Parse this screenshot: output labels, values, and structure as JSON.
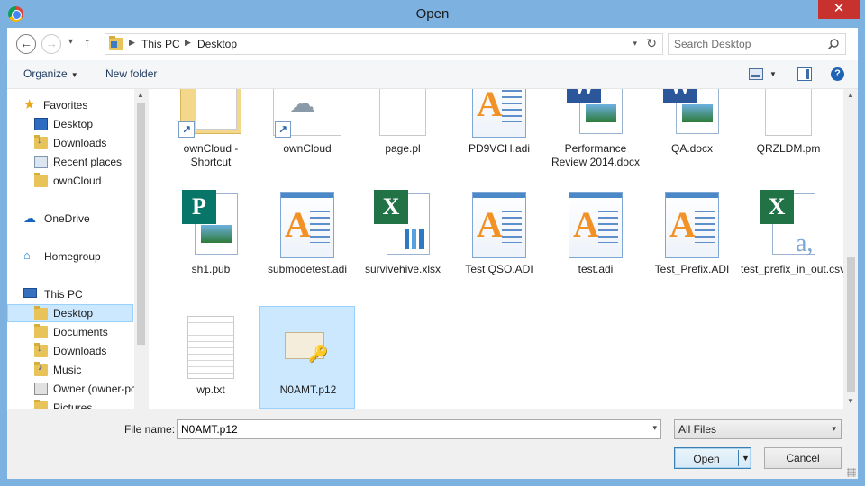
{
  "window": {
    "title": "Open",
    "close_glyph": "✕",
    "app_icon": "chrome-icon"
  },
  "nav": {
    "back_glyph": "←",
    "forward_glyph": "→",
    "recent_glyph": "▾",
    "up_glyph": "↑",
    "breadcrumb": [
      "This PC",
      "Desktop"
    ],
    "crumb_sep": "▶",
    "dropdown_glyph": "▾",
    "refresh_glyph": "↻",
    "search_placeholder": "Search Desktop"
  },
  "toolbar": {
    "organize_label": "Organize",
    "caret": "▼",
    "new_folder_label": "New folder",
    "help_glyph": "?"
  },
  "sidebar": {
    "items": [
      {
        "label": "Favorites",
        "icon": "star-icon"
      },
      {
        "label": "Desktop",
        "icon": "desktop-icon"
      },
      {
        "label": "Downloads",
        "icon": "downloads-icon"
      },
      {
        "label": "Recent places",
        "icon": "recent-places-icon"
      },
      {
        "label": "ownCloud",
        "icon": "folder-icon"
      },
      {
        "label": "OneDrive",
        "icon": "onedrive-icon"
      },
      {
        "label": "Homegroup",
        "icon": "homegroup-icon"
      },
      {
        "label": "This PC",
        "icon": "computer-icon"
      },
      {
        "label": "Desktop",
        "icon": "desktop-folder-icon"
      },
      {
        "label": "Documents",
        "icon": "documents-icon"
      },
      {
        "label": "Downloads",
        "icon": "downloads-folder-icon"
      },
      {
        "label": "Music",
        "icon": "music-icon"
      },
      {
        "label": "Owner (owner-pc",
        "icon": "user-drive-icon"
      },
      {
        "label": "Pictures",
        "icon": "pictures-icon"
      }
    ],
    "selected_index": 8,
    "scroll_up_glyph": "▲"
  },
  "files": [
    {
      "name": "ownCloud - Shortcut",
      "icon": "folder-shortcut-icon"
    },
    {
      "name": "ownCloud",
      "icon": "owncloud-shortcut-icon"
    },
    {
      "name": "page.pl",
      "icon": "generic-file-icon"
    },
    {
      "name": "PD9VCH.adi",
      "icon": "adi-file-icon"
    },
    {
      "name": "Performance Review 2014.docx",
      "icon": "word-doc-icon"
    },
    {
      "name": "QA.docx",
      "icon": "word-doc-icon"
    },
    {
      "name": "QRZLDM.pm",
      "icon": "generic-file-icon"
    },
    {
      "name": "sh1.pub",
      "icon": "publisher-file-icon"
    },
    {
      "name": "submodetest.adi",
      "icon": "adi-file-icon"
    },
    {
      "name": "survivehive.xlsx",
      "icon": "excel-file-icon"
    },
    {
      "name": "Test QSO.ADI",
      "icon": "adi-file-icon"
    },
    {
      "name": "test.adi",
      "icon": "adi-file-icon"
    },
    {
      "name": "Test_Prefix.ADI",
      "icon": "adi-file-icon"
    },
    {
      "name": "test_prefix_in_out.csv",
      "icon": "csv-file-icon"
    },
    {
      "name": "wp.txt",
      "icon": "text-file-icon"
    },
    {
      "name": "N0AMT.p12",
      "icon": "certificate-file-icon"
    }
  ],
  "selected_file": "N0AMT.p12",
  "scrollbar": {
    "up_glyph": "▲",
    "down_glyph": "▼"
  },
  "bottom": {
    "file_name_label": "File name:",
    "file_name_value": "N0AMT.p12",
    "dropdown_glyph": "▾",
    "file_type": "All Files",
    "open_label": "Open",
    "open_dd_glyph": "▼",
    "cancel_label": "Cancel"
  },
  "glyphs": {
    "star": "★",
    "cloud": "☁",
    "home": "⌂",
    "shortcut_arrow": "↗",
    "key": "🔑",
    "word": "W",
    "excel": "X",
    "publisher": "P",
    "adi": "A",
    "csv": "a,"
  }
}
